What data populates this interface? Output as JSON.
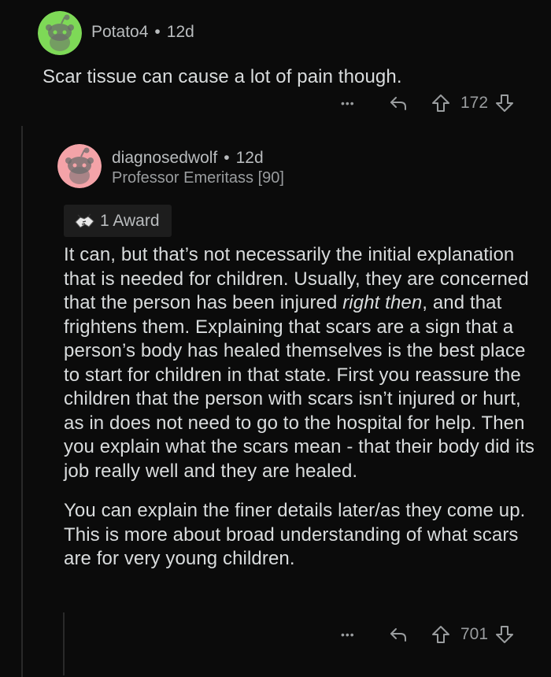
{
  "comments": [
    {
      "username": "Potato4",
      "separator": "•",
      "age": "12d",
      "body": "Scar tissue can cause a lot of pain though.",
      "more_label": "•••",
      "vote_count": "172",
      "avatar_color": "#7ed957"
    },
    {
      "username": "diagnosedwolf",
      "separator": "•",
      "age": "12d",
      "flair": "Professor Emeritass [90]",
      "award_label": "1 Award",
      "body_p1_a": "It can, but that’s not necessarily the initial explanation that is needed for children.  Usually, they are concerned that the person has been injured ",
      "body_p1_em": "right then",
      "body_p1_b": ", and that frightens them.  Explaining that scars are a sign that a person’s body has healed themselves is the best place to start for children in that state.  First you reassure the children that the person with scars isn’t injured or hurt, as in does not need to go to the hospital for help.  Then you explain what the scars mean - that their body did its job really well and they are healed.",
      "body_p2": "You can explain the finer details later/as they come up.  This is more about broad understanding of what scars are for very young children.",
      "more_label": "•••",
      "vote_count": "701",
      "avatar_color": "#f4a3a8"
    }
  ]
}
